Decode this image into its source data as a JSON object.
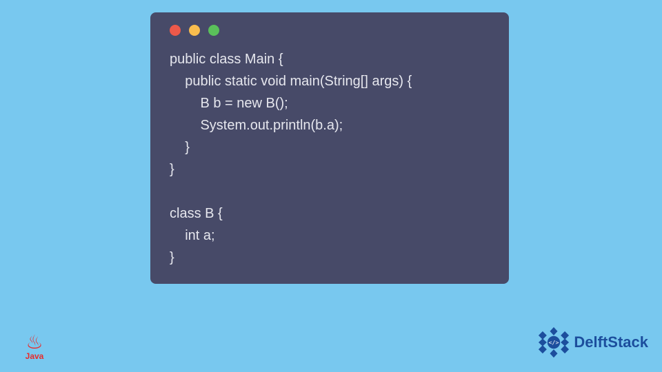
{
  "window": {
    "dots": [
      "red",
      "yellow",
      "green"
    ]
  },
  "code": {
    "text": "public class Main {\n    public static void main(String[] args) {\n        B b = new B();\n        System.out.println(b.a);\n    }\n}\n\nclass B {\n    int a;\n}"
  },
  "logos": {
    "java_label": "Java",
    "delft_label": "DelftStack"
  },
  "colors": {
    "page_bg": "#78c8ef",
    "window_bg": "#474a68",
    "code_fg": "#e6e7ee",
    "delft_blue": "#1c4e9d"
  }
}
